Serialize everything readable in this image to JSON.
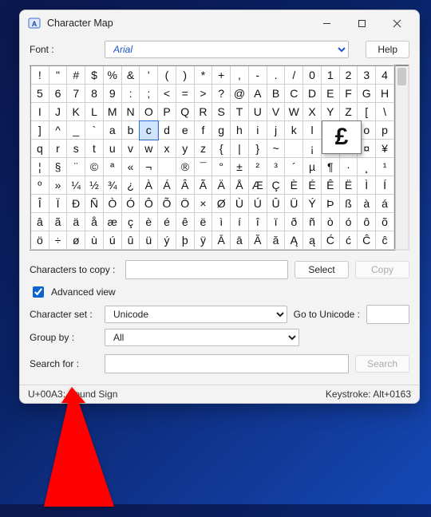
{
  "window": {
    "title": "Character Map"
  },
  "titlebar_icons": {
    "min": "minimize-icon",
    "max": "maximize-icon",
    "close": "close-icon"
  },
  "font_row": {
    "label": "Font :",
    "selected": "Arial",
    "help": "Help"
  },
  "grid": {
    "selected_index": 66,
    "magnified_char": "£",
    "chars": [
      "!",
      "\"",
      "#",
      "$",
      "%",
      "&",
      "'",
      "(",
      ")",
      "*",
      "+",
      ",",
      "-",
      ".",
      "/",
      "0",
      "1",
      "2",
      "3",
      "4",
      "5",
      "6",
      "7",
      "8",
      "9",
      ":",
      ";",
      "<",
      "=",
      ">",
      "?",
      "@",
      "A",
      "B",
      "C",
      "D",
      "E",
      "F",
      "G",
      "H",
      "I",
      "J",
      "K",
      "L",
      "M",
      "N",
      "O",
      "P",
      "Q",
      "R",
      "S",
      "T",
      "U",
      "V",
      "W",
      "X",
      "Y",
      "Z",
      "[",
      "\\",
      "]",
      "^",
      "_",
      "`",
      "a",
      "b",
      "c",
      "d",
      "e",
      "f",
      "g",
      "h",
      "i",
      "j",
      "k",
      "l",
      "m",
      "n",
      "o",
      "p",
      "q",
      "r",
      "s",
      "t",
      "u",
      "v",
      "w",
      "x",
      "y",
      "z",
      "{",
      "|",
      "}",
      "~",
      "",
      "¡",
      "¢",
      "£",
      "¤",
      "¥",
      "¦",
      "§",
      "¨",
      "©",
      "ª",
      "«",
      "¬",
      "­",
      "®",
      "¯",
      "°",
      "±",
      "²",
      "³",
      "´",
      "µ",
      "¶",
      "·",
      "¸",
      "¹",
      "º",
      "»",
      "¼",
      "½",
      "¾",
      "¿",
      "À",
      "Á",
      "Â",
      "Ã",
      "Ä",
      "Å",
      "Æ",
      "Ç",
      "È",
      "É",
      "Ê",
      "Ë",
      "Ì",
      "Í",
      "Î",
      "Ï",
      "Ð",
      "Ñ",
      "Ò",
      "Ó",
      "Ô",
      "Õ",
      "Ö",
      "×",
      "Ø",
      "Ù",
      "Ú",
      "Û",
      "Ü",
      "Ý",
      "Þ",
      "ß",
      "à",
      "á",
      "â",
      "ã",
      "ä",
      "å",
      "æ",
      "ç",
      "è",
      "é",
      "ê",
      "ë",
      "ì",
      "í",
      "î",
      "ï",
      "ð",
      "ñ",
      "ò",
      "ó",
      "ô",
      "õ",
      "ö",
      "÷",
      "ø",
      "ù",
      "ú",
      "û",
      "ü",
      "ý",
      "þ",
      "ÿ",
      "Ā",
      "ā",
      "Ă",
      "ă",
      "Ą",
      "ą",
      "Ć",
      "ć",
      "Ĉ",
      "ĉ"
    ]
  },
  "copy_row": {
    "label": "Characters to copy :",
    "value": "",
    "select": "Select",
    "copy": "Copy"
  },
  "adv": {
    "label": "Advanced view"
  },
  "charset": {
    "label": "Character set :",
    "selected": "Unicode",
    "goto_label": "Go to Unicode :",
    "goto_value": ""
  },
  "groupby": {
    "label": "Group by :",
    "selected": "All"
  },
  "search": {
    "label": "Search for :",
    "value": "",
    "button": "Search"
  },
  "status": {
    "left": "U+00A3: Pound Sign",
    "right": "Keystroke: Alt+0163"
  }
}
